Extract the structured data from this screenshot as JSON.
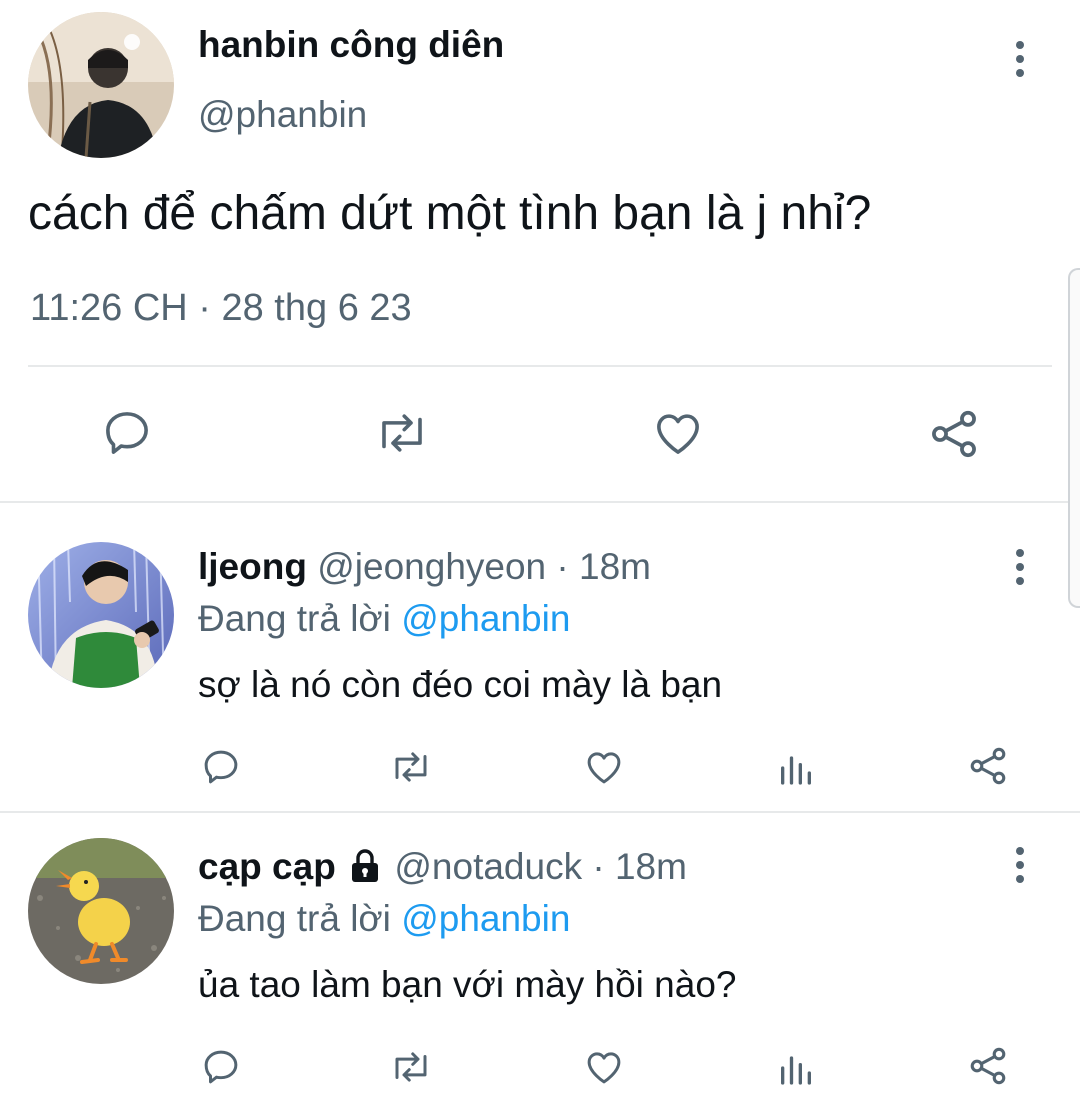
{
  "main_tweet": {
    "display_name": "hanbin công diên",
    "handle": "@phanbin",
    "text": "cách để chấm dứt một tình bạn là j nhỉ?",
    "timestamp": "11:26 CH · 28 thg 6 23",
    "actions": [
      "reply-icon",
      "retweet-icon",
      "like-icon",
      "share-icon"
    ]
  },
  "replies": [
    {
      "display_name": "ljeong",
      "handle": "@jeonghyeon",
      "time": " · 18m",
      "replying_prefix": "Đang trả lời ",
      "replying_to": "@phanbin",
      "text": "sợ là nó còn đéo coi mày là bạn",
      "locked": false
    },
    {
      "display_name": "cạp cạp",
      "handle": "@notaduck",
      "time": " · 18m",
      "replying_prefix": "Đang trả lời ",
      "replying_to": "@phanbin",
      "text": "ủa tao làm bạn với mày hồi nào?",
      "locked": true
    }
  ],
  "colors": {
    "text": "#0f1419",
    "muted": "#536471",
    "link": "#1d9bf0",
    "divider": "#e7e9ea"
  }
}
